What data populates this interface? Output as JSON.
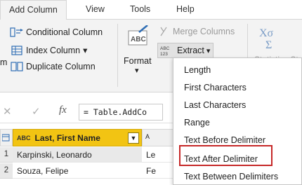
{
  "tabs": [
    {
      "label": "Add Column",
      "active": true
    },
    {
      "label": "View"
    },
    {
      "label": "Tools"
    },
    {
      "label": "Help"
    }
  ],
  "ribbon": {
    "conditional_column": "Conditional Column",
    "index_column": "Index Column",
    "index_caret": "▾",
    "duplicate_column": "Duplicate Column",
    "left_stub": "m",
    "format_label": "Format",
    "format_caret": "▾",
    "merge_columns": "Merge Columns",
    "extract_label": "Extract",
    "extract_caret": "▾",
    "statistics_partial": "Statistics Sta",
    "format_icon_text": "ABC",
    "extract_icon_text_top": "ABC",
    "extract_icon_text_bottom": "123"
  },
  "formula_bar": {
    "close_glyph": "✕",
    "check_glyph": "✓",
    "fx_glyph": "fx",
    "formula_text": "= Table.AddCo"
  },
  "grid": {
    "column_header": "Last, First Name",
    "type_icon": "ABC",
    "next_header_partial": "A",
    "rows": [
      {
        "num": "1",
        "name": "Karpinski, Leonardo",
        "next": "Le"
      },
      {
        "num": "2",
        "name": "Souza, Felipe",
        "next": "Fe"
      }
    ]
  },
  "extract_menu": {
    "items": [
      "Length",
      "First Characters",
      "Last Characters",
      "Range",
      "Text Before Delimiter",
      "Text After Delimiter",
      "Text Between Delimiters"
    ],
    "highlighted": "Text After Delimiter"
  },
  "colors": {
    "accent_yellow": "#f2c413",
    "highlight_red": "#c62828",
    "icon_blue": "#2e6db4"
  }
}
